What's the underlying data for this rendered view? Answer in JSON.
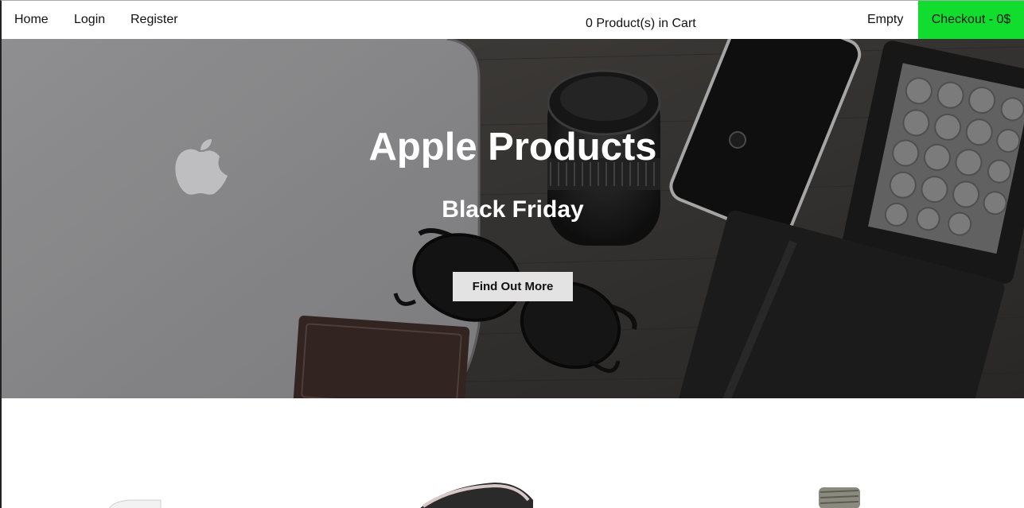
{
  "nav": {
    "home": "Home",
    "login": "Login",
    "register": "Register"
  },
  "cart": {
    "count_text": "0 Product(s) in Cart",
    "status": "Empty",
    "checkout_label": "Checkout - 0$"
  },
  "hero": {
    "title": "Apple Products",
    "subtitle": "Black Friday",
    "cta_label": "Find Out More"
  },
  "colors": {
    "checkout_bg": "#11dd2e",
    "cta_bg": "#e3e3e3"
  },
  "icons": {
    "apple_logo": "apple-logo-icon",
    "camera_lens": "camera-lens-icon",
    "smartphone": "smartphone-icon",
    "ereader": "ereader-icon",
    "sunglasses": "sunglasses-icon",
    "notebook": "notebook-icon",
    "wallet": "wallet-icon"
  }
}
